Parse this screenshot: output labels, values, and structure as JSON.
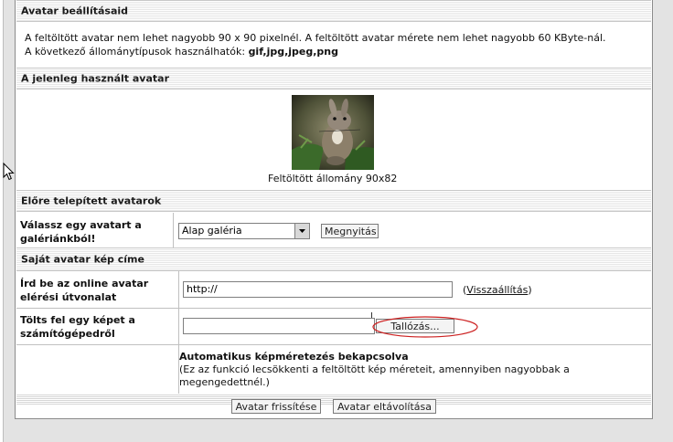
{
  "sections": {
    "settings_title": "Avatar beállításaid",
    "settings_line1": "A feltöltött avatar nem lehet nagyobb 90 x 90 pixelnél. A feltöltött avatar mérete nem lehet nagyobb 60 KByte-nál.",
    "settings_line2_prefix": "A következő állománytípusok használhatók:",
    "settings_line2_types": "gif,jpg,jpeg,png",
    "current_title": "A jelenleg használt avatar",
    "current_caption": "Feltöltött állomány 90x82",
    "gallery_title": "Előre telepített avatarok",
    "own_title": "Saját avatar kép címe"
  },
  "gallery": {
    "label_line1": "Válassz egy avatart a",
    "label_line2": "galériánkból!",
    "select_value": "Alap galéria",
    "open_button": "Megnyitás"
  },
  "url_row": {
    "label_line1": "Írd be az online avatar",
    "label_line2": "elérési útvonalat",
    "input_value": "http://",
    "reset_link": "Visszaállítás",
    "paren_open": "(",
    "paren_close": ")"
  },
  "upload_row": {
    "label_line1": "Tölts fel egy képet a",
    "label_line2": "számítógépedről",
    "file_value": "",
    "browse_button": "Tallózás..."
  },
  "auto_row": {
    "title": "Automatikus képméretezés bekapcsolva",
    "desc_line1": "(Ez az funkció lecsökkenti a feltöltött kép méreteit, amennyiben nagyobbak a",
    "desc_line2": "megengedettnél.)"
  },
  "footer": {
    "update_button": "Avatar frissítése",
    "remove_button": "Avatar eltávolítása"
  },
  "colors": {
    "background": "#e3e3e3",
    "annotation_ellipse": "#cc1f1f"
  },
  "icons": {
    "cursor": "mouse-pointer-icon",
    "dropdown": "dropdown-arrow-icon"
  }
}
